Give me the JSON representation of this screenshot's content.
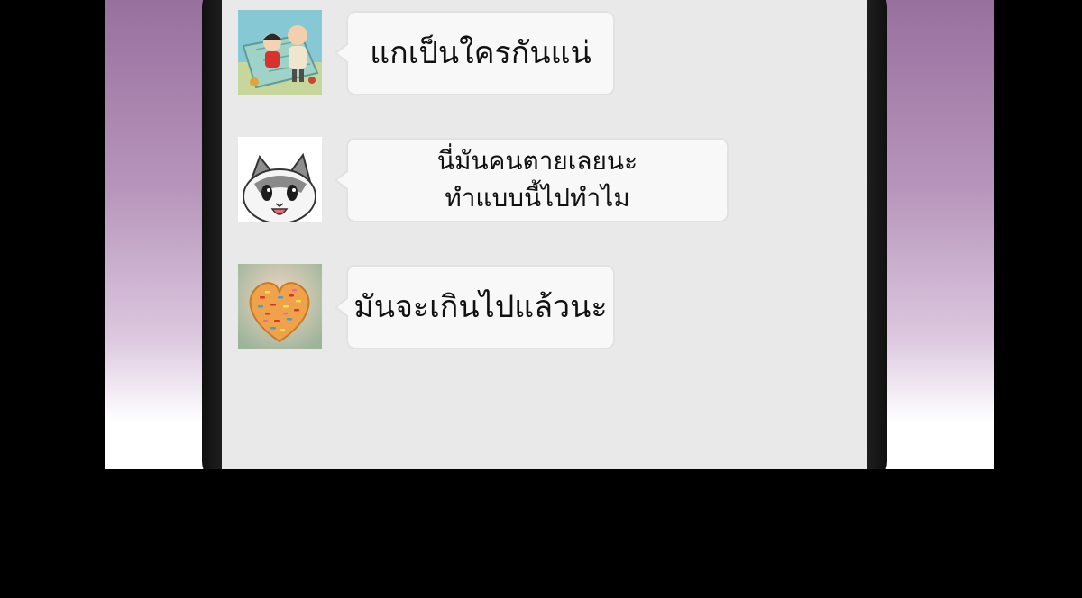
{
  "messages": [
    {
      "text": "แกเป็นใครกันแน่",
      "avatar": "cartoon-couple-picnic"
    },
    {
      "lines": [
        "นี่มันคนตายเลยนะ",
        "ทำแบบนี้ไปทำไม"
      ],
      "avatar": "cartoon-cat-face"
    },
    {
      "text": "มันจะเกินไปแล้วนะ",
      "avatar": "heart-cookie-sprinkles"
    }
  ]
}
